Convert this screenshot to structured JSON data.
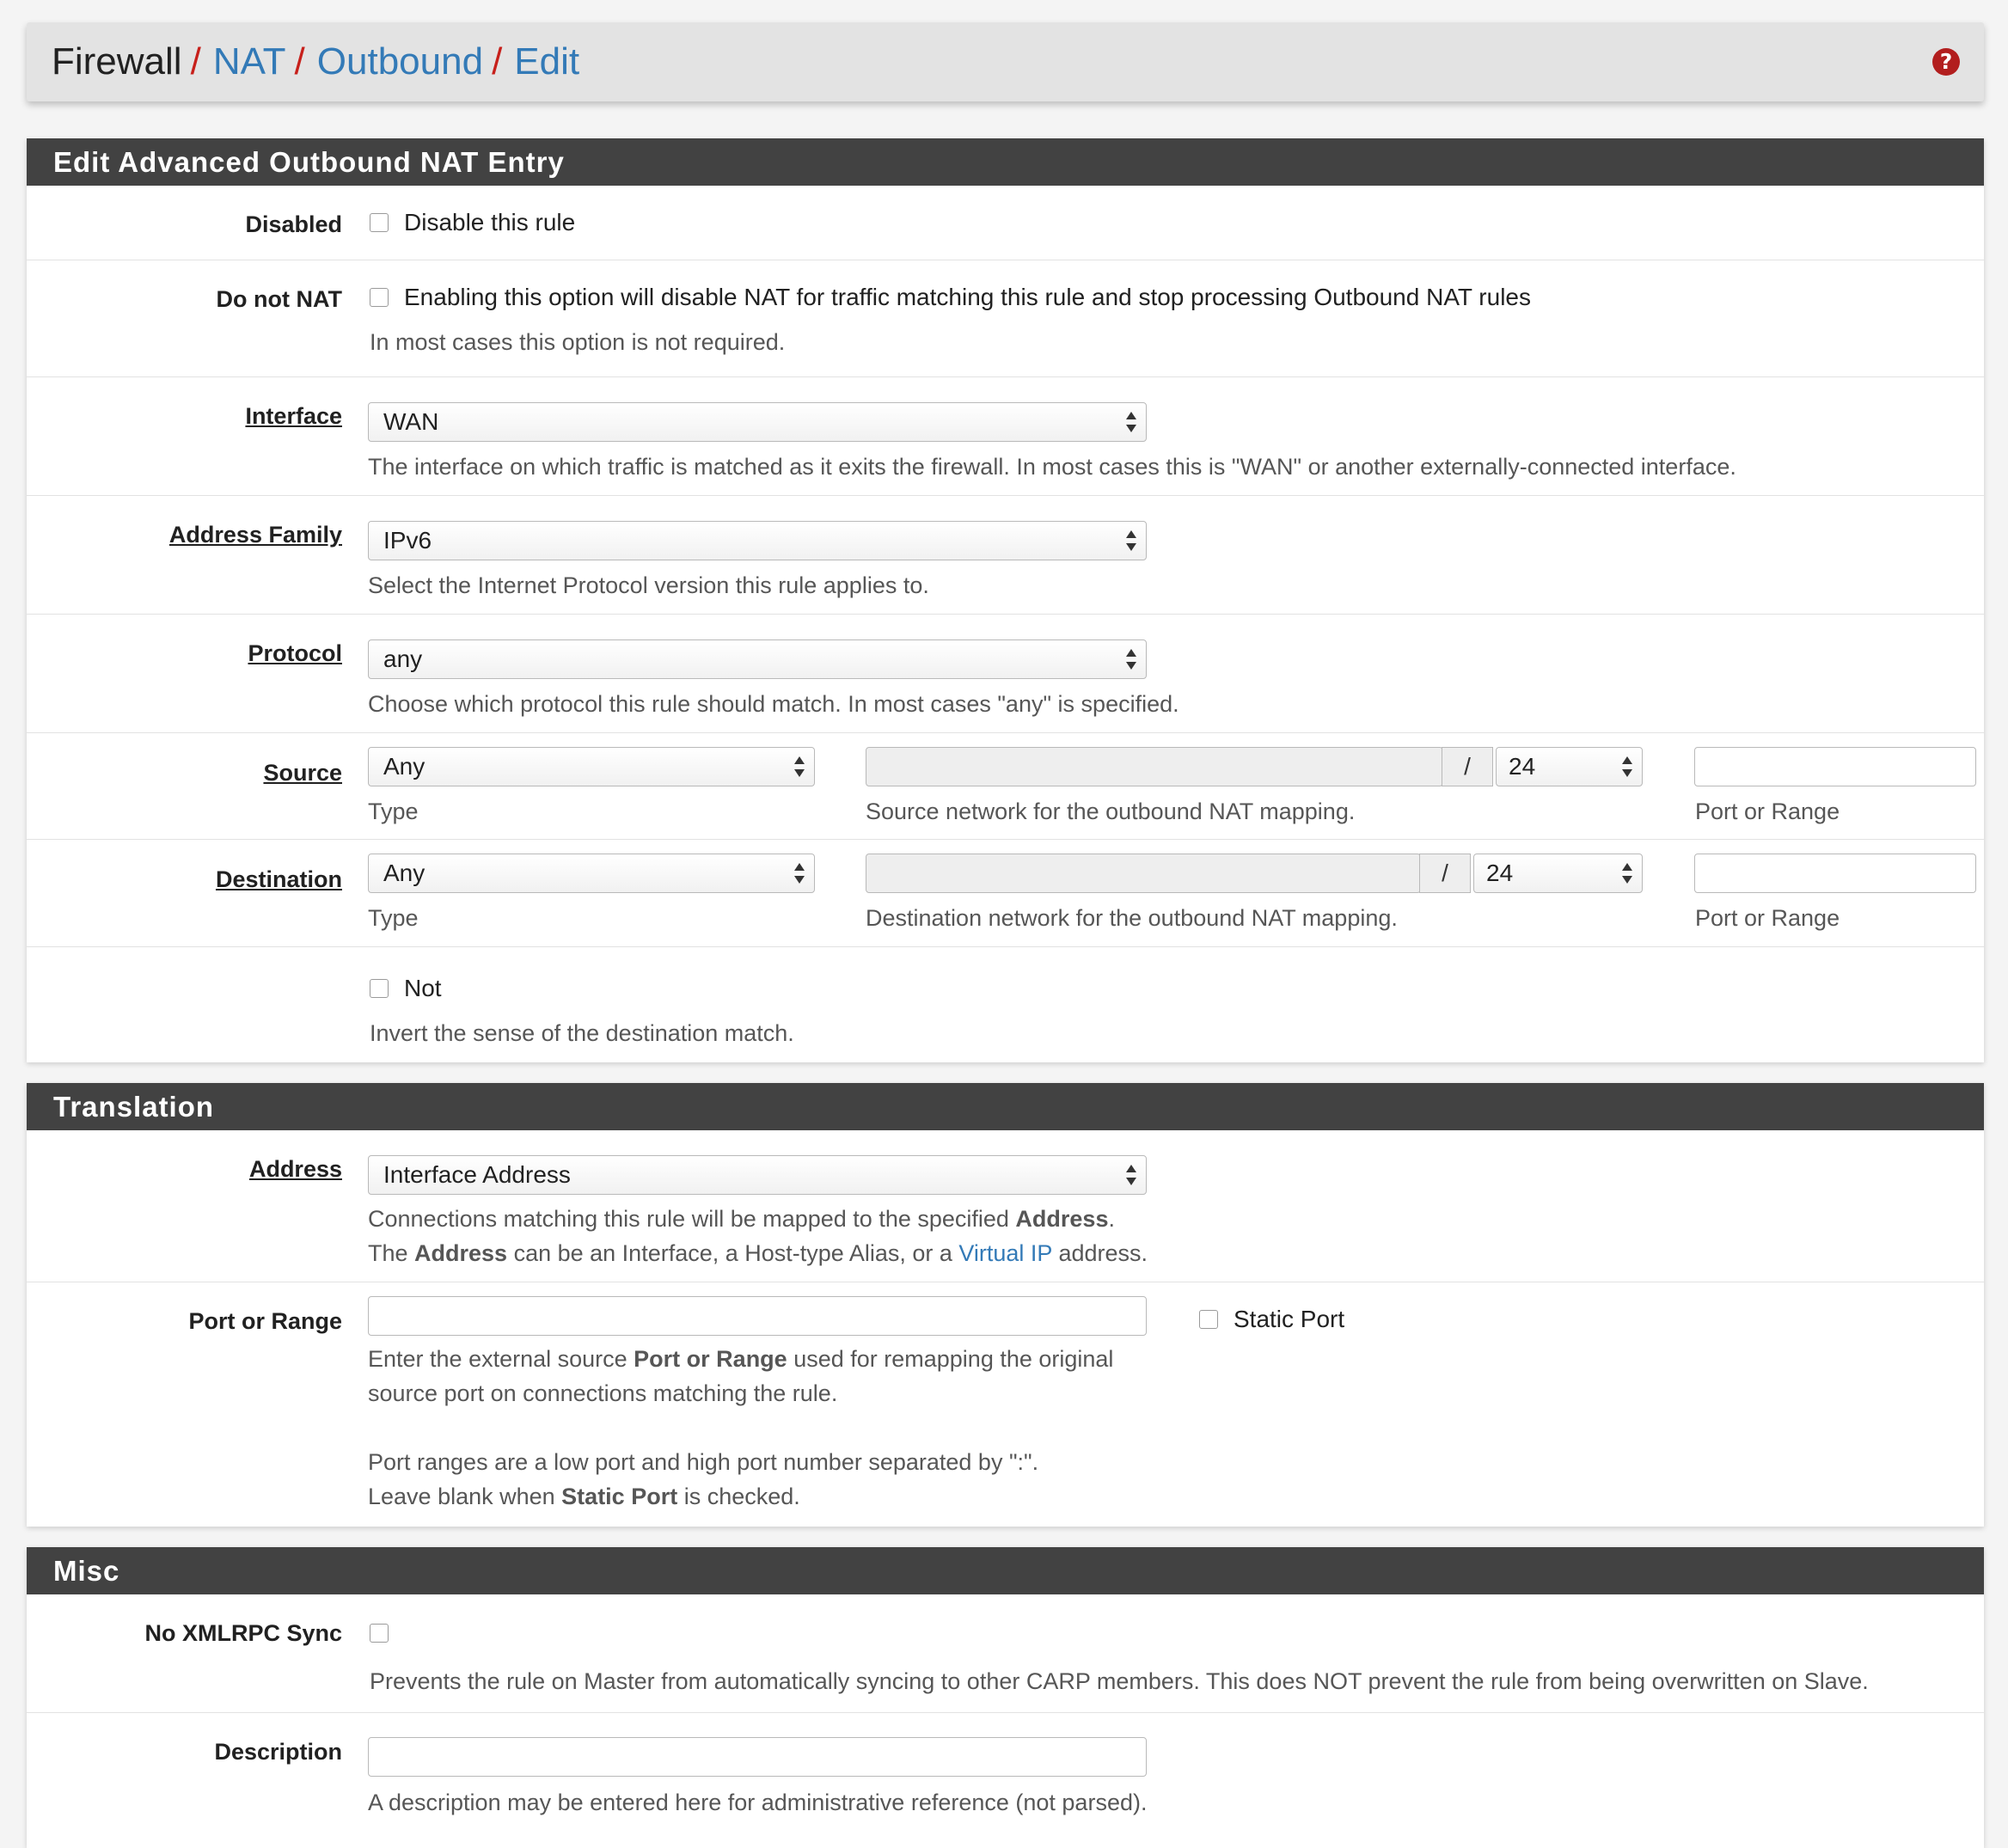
{
  "breadcrumb": {
    "firewall": "Firewall",
    "nat": "NAT",
    "outbound": "Outbound",
    "edit": "Edit",
    "separator": "/"
  },
  "help_icon": "question-circle-icon",
  "panel_main": {
    "title": "Edit Advanced Outbound NAT Entry",
    "disabled": {
      "label": "Disabled",
      "checkbox_label": "Disable this rule",
      "checked": false
    },
    "donotnat": {
      "label": "Do not NAT",
      "checkbox_label": "Enabling this option will disable NAT for traffic matching this rule and stop processing Outbound NAT rules",
      "help": "In most cases this option is not required.",
      "checked": false
    },
    "interface": {
      "label": "Interface",
      "value": "WAN",
      "help": "The interface on which traffic is matched as it exits the firewall. In most cases this is \"WAN\" or another externally-connected interface."
    },
    "address_family": {
      "label": "Address Family",
      "value": "IPv6",
      "help": "Select the Internet Protocol version this rule applies to."
    },
    "protocol": {
      "label": "Protocol",
      "value": "any",
      "help": "Choose which protocol this rule should match. In most cases \"any\" is specified."
    },
    "source": {
      "label": "Source",
      "type_value": "Any",
      "type_help": "Type",
      "network_value": "",
      "slash": "/",
      "mask_value": "24",
      "network_help": "Source network for the outbound NAT mapping.",
      "port_value": "",
      "port_help": "Port or Range"
    },
    "destination": {
      "label": "Destination",
      "type_value": "Any",
      "type_help": "Type",
      "network_value": "",
      "slash": "/",
      "mask_value": "24",
      "network_help": "Destination network for the outbound NAT mapping.",
      "port_value": "",
      "port_help": "Port or Range"
    },
    "not": {
      "checkbox_label": "Not",
      "help": "Invert the sense of the destination match.",
      "checked": false
    }
  },
  "panel_translation": {
    "title": "Translation",
    "address": {
      "label": "Address",
      "value": "Interface Address",
      "help1_pre": "Connections matching this rule will be mapped to the specified ",
      "help1_bold": "Address",
      "help1_post": ".",
      "help2_pre": "The ",
      "help2_bold": "Address",
      "help2_mid": " can be an Interface, a Host-type Alias, or a ",
      "help2_link": "Virtual IP",
      "help2_post": " address."
    },
    "port": {
      "label": "Port or Range",
      "value": "",
      "static_port_label": "Static Port",
      "static_port_checked": false,
      "help1_pre": "Enter the external source ",
      "help1_bold": "Port or Range",
      "help1_post": " used for remapping the original",
      "help2": "source port on connections matching the rule.",
      "help3": "Port ranges are a low port and high port number separated by \":\".",
      "help4_pre": "Leave blank when ",
      "help4_bold": "Static Port",
      "help4_post": " is checked."
    }
  },
  "panel_misc": {
    "title": "Misc",
    "xmlrpc": {
      "label": "No XMLRPC Sync",
      "checked": false,
      "help": "Prevents the rule on Master from automatically syncing to other CARP members. This does NOT prevent the rule from being overwritten on Slave."
    },
    "description": {
      "label": "Description",
      "value": "",
      "help": "A description may be entered here for administrative reference (not parsed)."
    }
  },
  "colors": {
    "panel_header": "#424242",
    "link": "#337ab7",
    "separator": "#c7201b",
    "help_icon": "#b21e1e"
  }
}
